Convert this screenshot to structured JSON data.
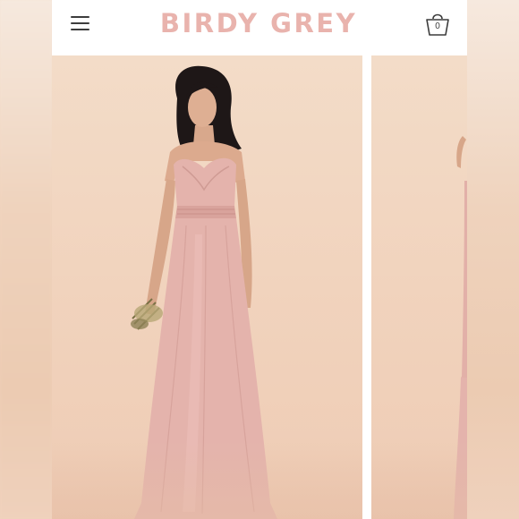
{
  "header": {
    "brand": "BIRDY GREY",
    "brand_color": "#e9b3ad",
    "menu_icon": "hamburger-menu-icon",
    "cart_icon": "shopping-bag-icon",
    "cart_count": "0"
  },
  "gallery": {
    "images": [
      {
        "subject": "model-in-pink-strapless-gown",
        "dress_color": "#e4b3ac"
      },
      {
        "subject": "model-in-pink-gown-side-view",
        "dress_color": "#e4b3ac"
      }
    ]
  }
}
